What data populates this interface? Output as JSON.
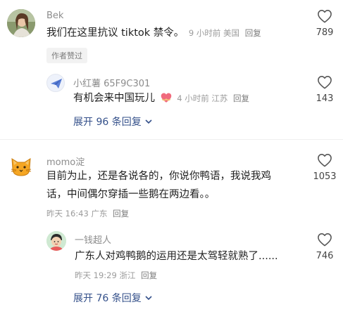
{
  "comments": [
    {
      "username": "Bek",
      "text": "我们在这里抗议 tiktok 禁令。",
      "time": "9 小时前",
      "location": "美国",
      "reply_label": "回复",
      "likes": "789",
      "badge": "作者赞过",
      "avatar_icon": "woman-photo-avatar",
      "replies": [
        {
          "username": "小红薯 65F9C301",
          "text": "有机会来中国玩儿",
          "emoji": "heart-hands-emoji",
          "time": "4 小时前",
          "location": "江苏",
          "reply_label": "回复",
          "likes": "143",
          "avatar_icon": "paper-plane-avatar"
        }
      ],
      "expand_label": "展开 96 条回复"
    },
    {
      "username": "momo淀",
      "text_line1": "目前为止，还是各说各的，你说你鸭语，我说我鸡",
      "text_line2": "话，中间偶尔穿插一些鹅在两边看。。",
      "time": "昨天 16:43",
      "location": "广东",
      "reply_label": "回复",
      "likes": "1053",
      "avatar_icon": "cat-emoji-avatar",
      "replies": [
        {
          "username": "一钱超人",
          "text": "广东人对鸡鸭鹅的运用还是太驾轻就熟了......",
          "time": "昨天 19:29",
          "location": "浙江",
          "reply_label": "回复",
          "likes": "746",
          "avatar_icon": "cartoon-person-avatar"
        }
      ],
      "expand_label": "展开 76 条回复"
    }
  ],
  "colors": {
    "link": "#34508a",
    "muted": "#9b9b9b",
    "text": "#1f1f1f"
  }
}
